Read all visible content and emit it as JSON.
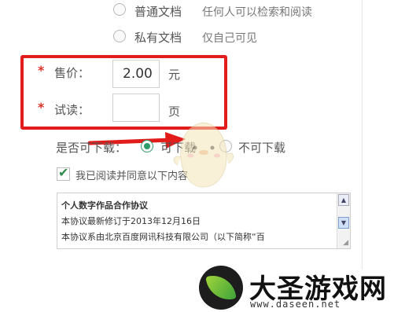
{
  "visibility": {
    "public_label": "普通文档",
    "public_hint": "任何人可以检索和阅读",
    "private_label": "私有文档",
    "private_hint": "仅自己可见"
  },
  "price": {
    "label": "售价：",
    "value": "2.00",
    "unit": "元"
  },
  "trial": {
    "label": "试读：",
    "value": "",
    "unit": "页"
  },
  "download": {
    "label": "是否可下载：",
    "allow_label": "可下载",
    "deny_label": "不可下载",
    "selected": "allow"
  },
  "agree": {
    "label": "我已阅读并同意以下内容",
    "checked": true
  },
  "agreement": {
    "title": "个人数字作品合作协议",
    "line1": "本协议最新修订于2013年12月16日",
    "line2": "本协议系由北京百度网讯科技有限公司（以下简称“百"
  },
  "brand": {
    "name": "大圣游戏网",
    "url": "www.daseen.net"
  },
  "colors": {
    "accent_green": "#2e9c6a",
    "highlight_red": "#e21b1b",
    "required_star": "#d9352b"
  }
}
